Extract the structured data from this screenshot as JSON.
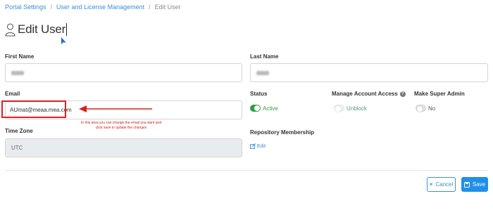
{
  "breadcrumb": {
    "items": [
      "Portal Settings",
      "User and License Management"
    ],
    "current": "Edit User",
    "separator": "/"
  },
  "page": {
    "title": "Edit User"
  },
  "form": {
    "first_name": {
      "label": "First Name"
    },
    "last_name": {
      "label": "Last Name"
    },
    "email": {
      "label": "Email",
      "value": "AUmat@meaa.mea.com"
    },
    "status": {
      "label": "Status",
      "toggle_text": "Active",
      "state": "on"
    },
    "manage_account_access": {
      "label": "Manage Account Access",
      "toggle_text": "Unblock",
      "state": "off-disabled"
    },
    "make_super_admin": {
      "label": "Make Super Admin",
      "toggle_text": "No",
      "state": "off"
    },
    "time_zone": {
      "label": "Time Zone",
      "value": "UTC"
    },
    "repository_membership": {
      "label": "Repository Membership",
      "edit_label": "Edit"
    }
  },
  "annotation": {
    "note": "In this area you can change the email you want and click save to update the changes",
    "color": "#d42020"
  },
  "actions": {
    "cancel_label": "Cancel",
    "save_label": "Save"
  },
  "colors": {
    "accent": "#1f8fe8",
    "link": "#3a8fd6",
    "active": "#2e9e3e"
  }
}
